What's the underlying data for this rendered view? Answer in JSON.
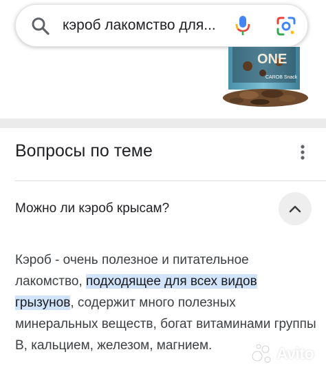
{
  "search": {
    "query": "кэроб лакомство для..."
  },
  "product_image": {
    "label_text": "ONE",
    "sub_text": "CAROB Snack"
  },
  "questions_section": {
    "title": "Вопросы по теме",
    "items": [
      {
        "question": "Можно ли кэроб крысам?",
        "answer_before": "Кэроб - очень полезное и питательное лакомство, ",
        "answer_highlight": "подходящее для всех видов грызунов",
        "answer_after": ", содержит много полезных минеральных веществ, богат витаминами группы В, кальцием, железом, магнием."
      }
    ]
  },
  "watermark": {
    "text": "Avito"
  },
  "colors": {
    "highlight": "#d2e3fc",
    "divider": "#ebebeb",
    "google_blue": "#4285f4",
    "google_red": "#ea4335",
    "google_yellow": "#fbbc05",
    "google_green": "#34a853"
  }
}
